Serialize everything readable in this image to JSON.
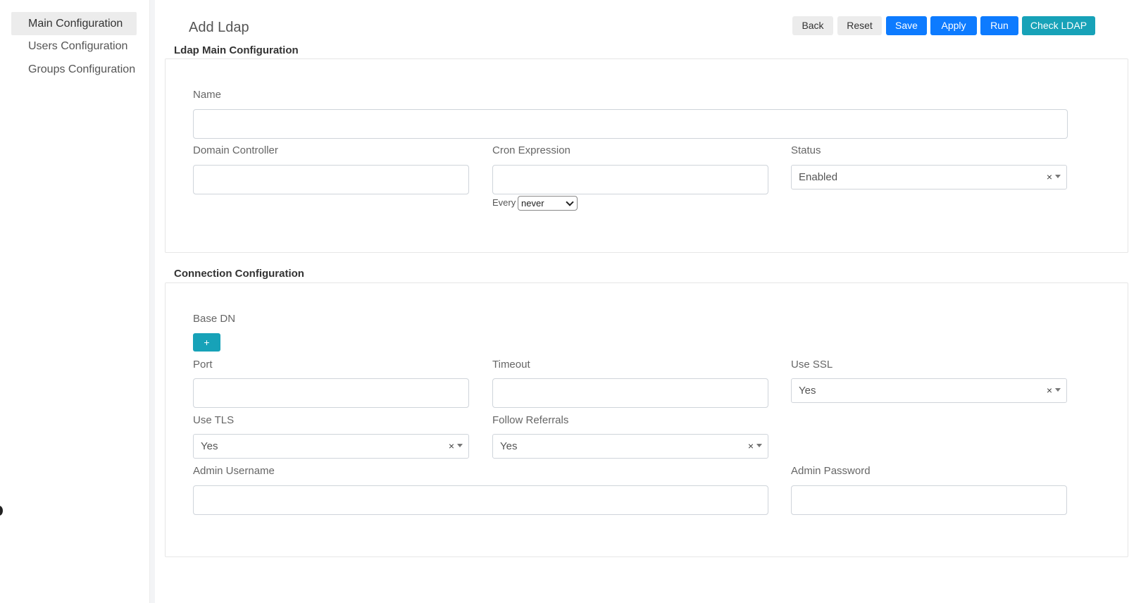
{
  "sidebar": {
    "items": [
      {
        "label": "Main Configuration"
      },
      {
        "label": "Users Configuration"
      },
      {
        "label": "Groups Configuration"
      }
    ]
  },
  "page": {
    "title": "Add Ldap"
  },
  "toolbar": {
    "back": "Back",
    "reset": "Reset",
    "save": "Save",
    "apply": "Apply",
    "run": "Run",
    "check": "Check LDAP"
  },
  "main_config": {
    "title": "Ldap Main Configuration",
    "name": {
      "label": "Name",
      "value": ""
    },
    "domain_controller": {
      "label": "Domain Controller",
      "value": ""
    },
    "cron": {
      "label": "Cron Expression",
      "value": "",
      "every_label": "Every",
      "every_value": "never"
    },
    "status": {
      "label": "Status",
      "value": "Enabled",
      "clear": "×"
    }
  },
  "connection_config": {
    "title": "Connection Configuration",
    "base_dn": {
      "label": "Base DN",
      "add_label": "+"
    },
    "port": {
      "label": "Port",
      "value": ""
    },
    "timeout": {
      "label": "Timeout",
      "value": ""
    },
    "use_ssl": {
      "label": "Use SSL",
      "value": "Yes",
      "clear": "×"
    },
    "use_tls": {
      "label": "Use TLS",
      "value": "Yes",
      "clear": "×"
    },
    "follow_referrals": {
      "label": "Follow Referrals",
      "value": "Yes",
      "clear": "×"
    },
    "admin_username": {
      "label": "Admin Username",
      "value": ""
    },
    "admin_password": {
      "label": "Admin Password",
      "value": ""
    }
  }
}
